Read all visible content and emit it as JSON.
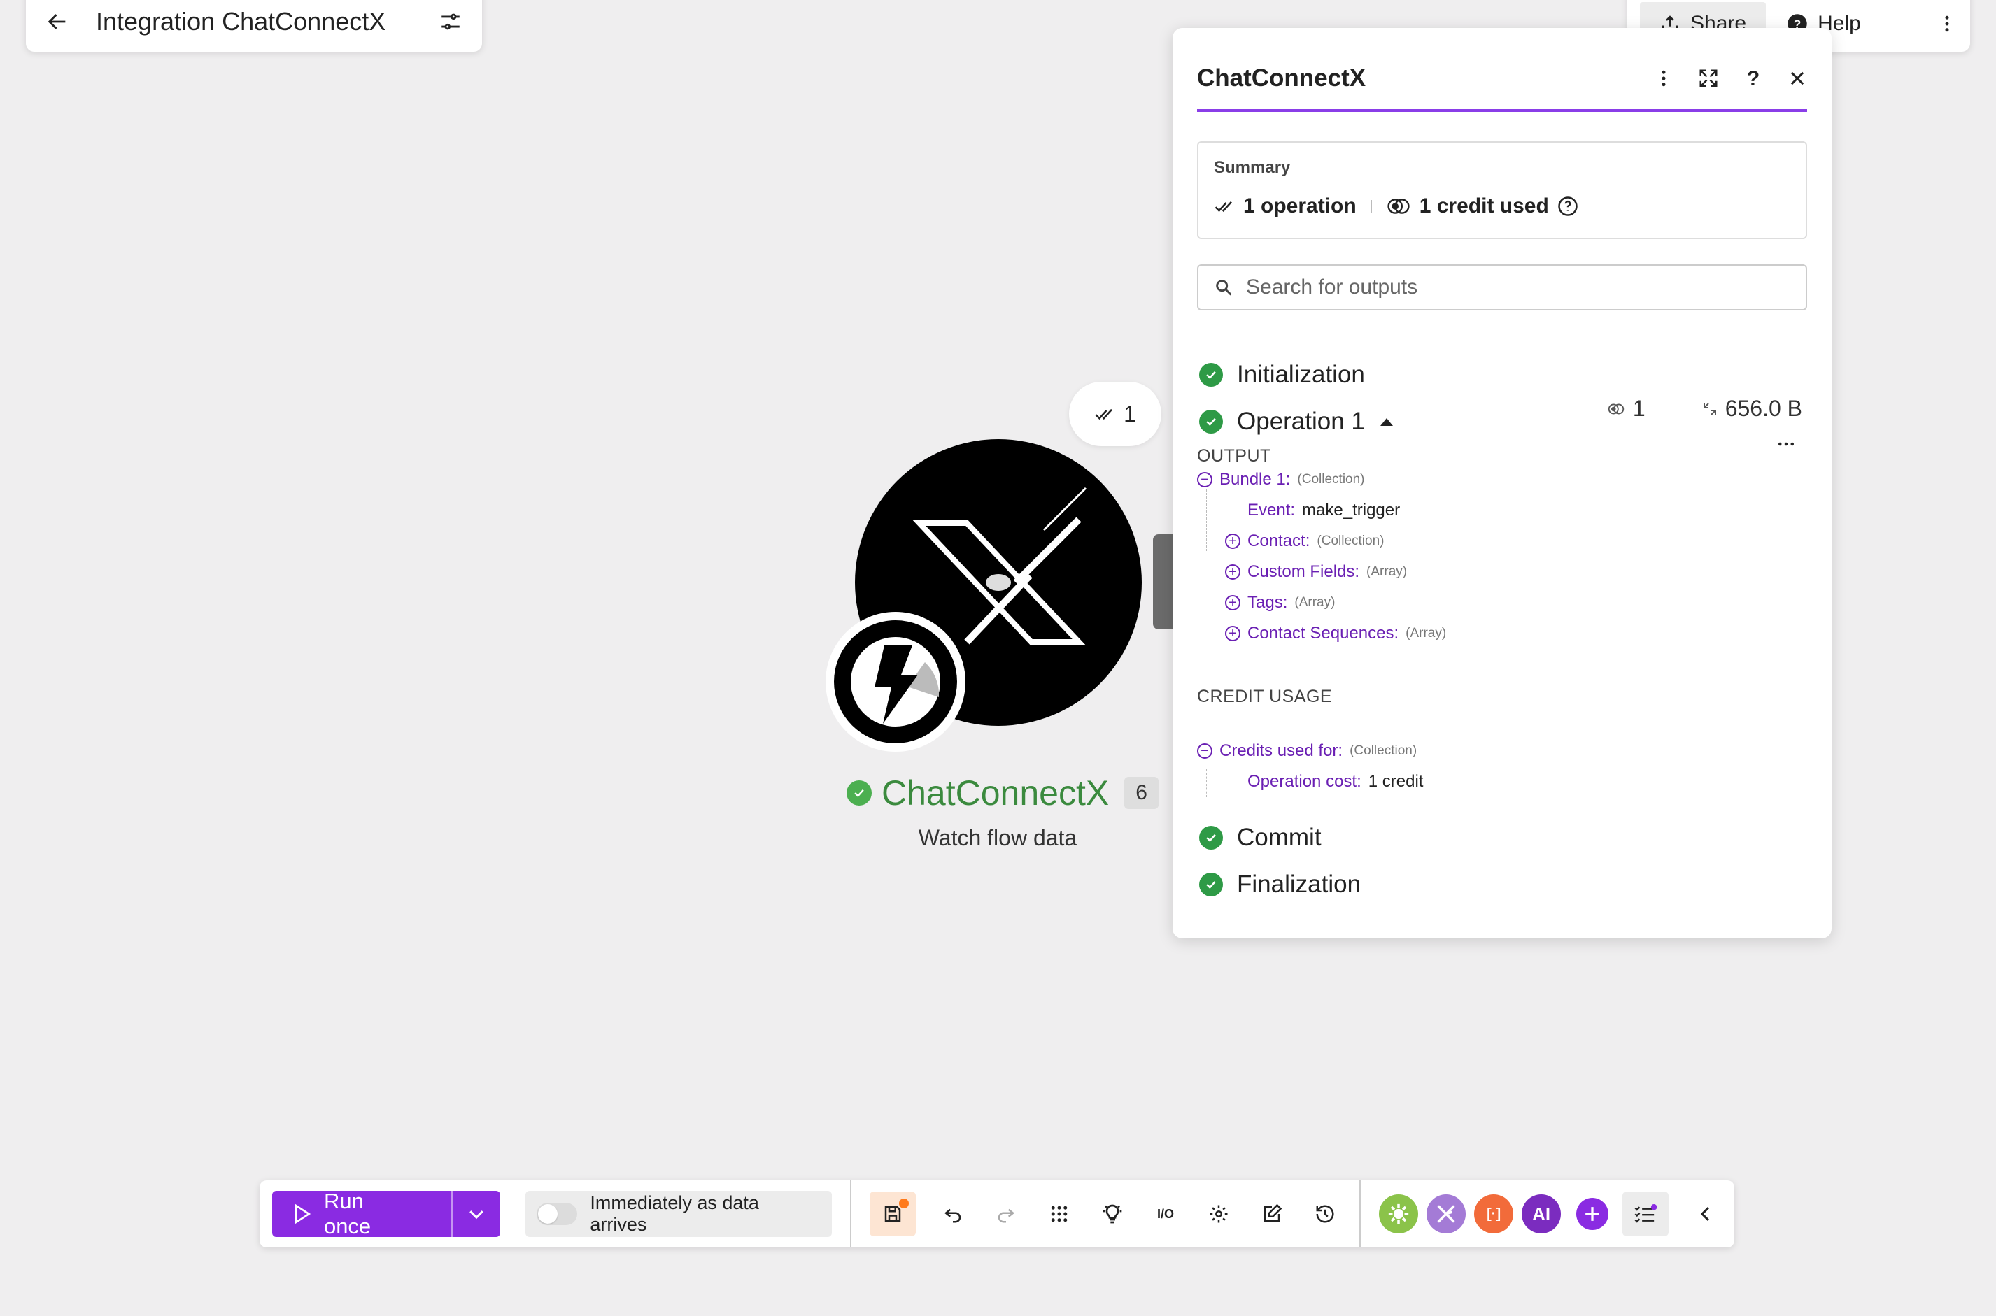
{
  "header": {
    "back_label": "Back",
    "title": "Integration ChatConnectX"
  },
  "topright": {
    "share": "Share",
    "help": "Help"
  },
  "module": {
    "name": "ChatConnectX",
    "count": "6",
    "subtitle": "Watch flow data",
    "bubble_count": "1"
  },
  "panel": {
    "title": "ChatConnectX",
    "summary": {
      "label": "Summary",
      "operations": "1 operation",
      "credits": "1 credit used"
    },
    "search_placeholder": "Search for outputs",
    "phases": {
      "initialization": "Initialization",
      "operation": "Operation 1",
      "commit": "Commit",
      "finalization": "Finalization"
    },
    "op_stats": {
      "bundles": "1",
      "size": "656.0 B"
    },
    "output_label": "OUTPUT",
    "output_tree": [
      {
        "key": "Bundle 1:",
        "type": "(Collection)",
        "value": "",
        "toggle": "minus",
        "level": 0
      },
      {
        "key": "Event:",
        "type": "",
        "value": "make_trigger",
        "toggle": "",
        "level": 1
      },
      {
        "key": "Contact:",
        "type": "(Collection)",
        "value": "",
        "toggle": "plus",
        "level": 1
      },
      {
        "key": "Custom Fields:",
        "type": "(Array)",
        "value": "",
        "toggle": "plus",
        "level": 1
      },
      {
        "key": "Tags:",
        "type": "(Array)",
        "value": "",
        "toggle": "plus",
        "level": 1
      },
      {
        "key": "Contact Sequences:",
        "type": "(Array)",
        "value": "",
        "toggle": "plus",
        "level": 1
      }
    ],
    "credit_label": "CREDIT USAGE",
    "credit_tree": [
      {
        "key": "Credits used for:",
        "type": "(Collection)",
        "value": "",
        "toggle": "minus",
        "level": 0
      },
      {
        "key": "Operation cost:",
        "type": "",
        "value": "1 credit",
        "toggle": "",
        "level": 1
      }
    ]
  },
  "toolbar": {
    "run_label": "Run once",
    "schedule_label": "Immediately as data arrives",
    "apps": [
      {
        "name": "tools-app",
        "color": "#8bc34a",
        "text": ""
      },
      {
        "name": "flow-control-app",
        "color": "#a47bd6",
        "text": ""
      },
      {
        "name": "text-parser-app",
        "color": "#f26b3a",
        "text": "[·]"
      },
      {
        "name": "ai-app",
        "color": "#7b2cbf",
        "text": "AI"
      }
    ]
  }
}
